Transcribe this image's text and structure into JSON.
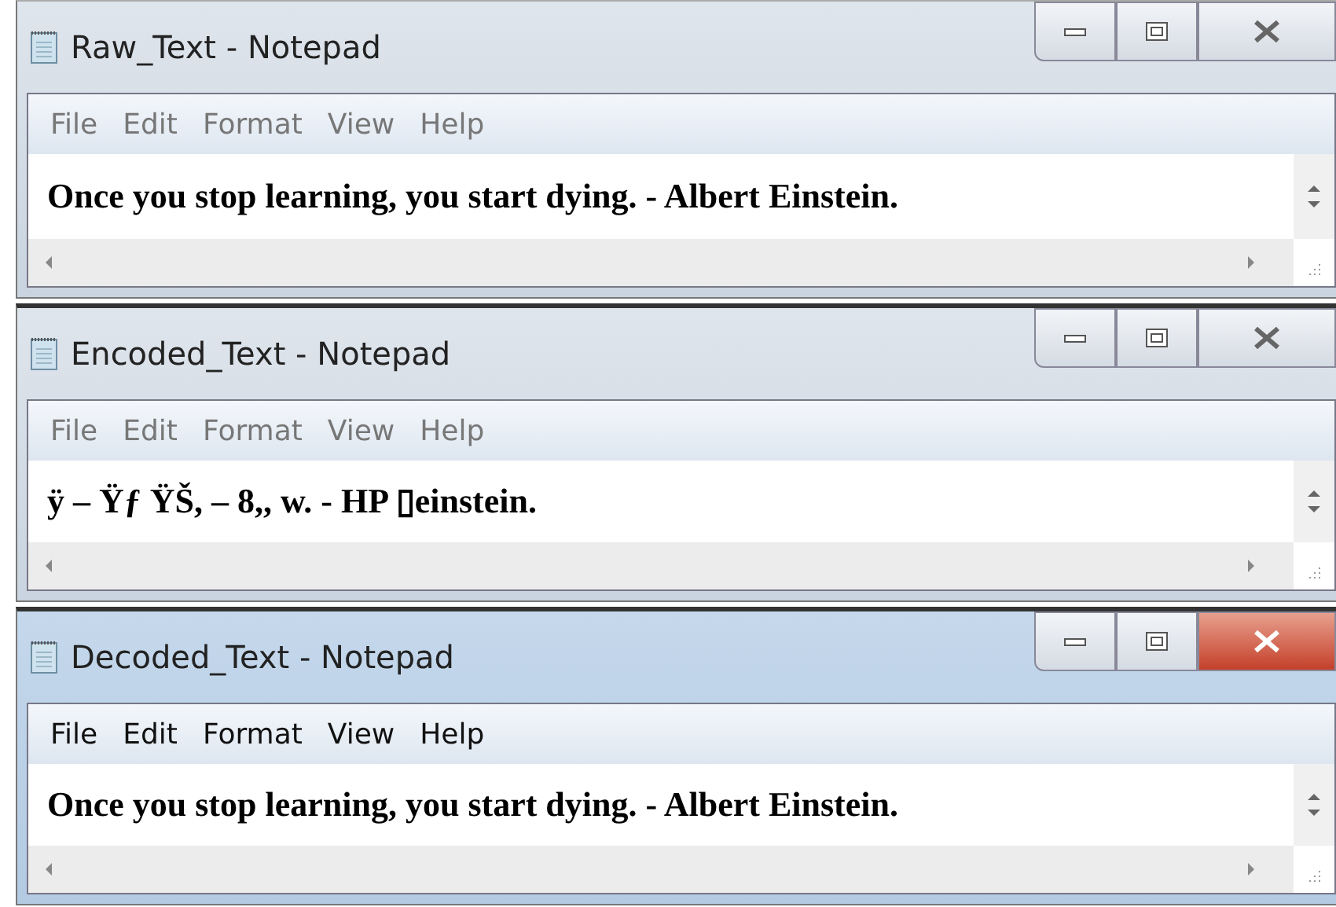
{
  "windows": [
    {
      "title": "Raw_Text - Notepad",
      "active": false,
      "menu": [
        "File",
        "Edit",
        "Format",
        "View",
        "Help"
      ],
      "text": "Once you stop learning, you start dying. - Albert Einstein."
    },
    {
      "title": "Encoded_Text - Notepad",
      "active": false,
      "menu": [
        "File",
        "Edit",
        "Format",
        "View",
        "Help"
      ],
      "text": "ÿ – Ÿƒ ŸŠ, – 8,, w. -  HP ▯einstein."
    },
    {
      "title": "Decoded_Text - Notepad",
      "active": true,
      "menu": [
        "File",
        "Edit",
        "Format",
        "View",
        "Help"
      ],
      "text": "Once you stop learning, you start dying. - Albert Einstein."
    }
  ]
}
